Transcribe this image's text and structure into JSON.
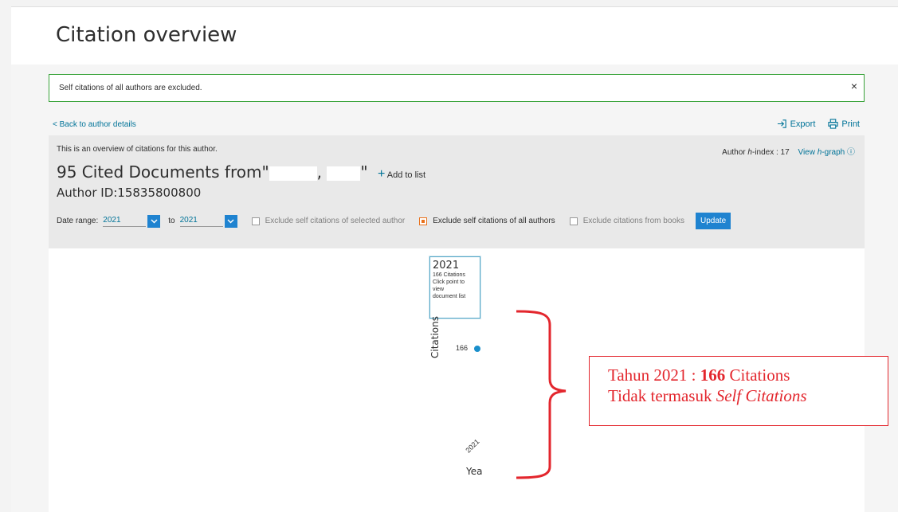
{
  "page": {
    "title": "Citation overview"
  },
  "notice": {
    "text": "Self citations of all authors are excluded.",
    "close": "×"
  },
  "nav": {
    "back": "< Back to author details",
    "export": "Export",
    "print": "Print"
  },
  "overview": {
    "intro": "This is an overview of citations for this author.",
    "hindex_prefix": "Author ",
    "hindex_h": "h",
    "hindex_suffix": "-index : 17",
    "view_prefix": "View ",
    "view_h": "h",
    "view_suffix": "-graph",
    "docs_prefix": "95 Cited Documents from\"",
    "docs_comma": ",",
    "docs_quote": "\"",
    "add_to_list": "Add to list",
    "author_id": "Author ID:15835800800"
  },
  "filters": {
    "date_range_label": "Date range:",
    "from_value": "2021",
    "to_label": "to",
    "to_value": "2021",
    "exclude_selected": "Exclude self citations of selected author",
    "exclude_all": "Exclude self citations of all authors",
    "exclude_books": "Exclude citations from books",
    "update": "Update"
  },
  "chart_data": {
    "type": "scatter",
    "x": [
      "2021"
    ],
    "values": [
      166
    ],
    "ylabel": "Citations",
    "xlabel": "Yea",
    "tooltip": {
      "year": "2021",
      "lines": [
        "166 Citations",
        "Click point to",
        "view",
        "document list"
      ]
    },
    "point_color": "#1a8fcb"
  },
  "annotation": {
    "line1_prefix": "Tahun 2021 : ",
    "line1_bold": "166",
    "line1_suffix": " Citations",
    "line2_prefix": "Tidak termasuk ",
    "line2_italic": "Self Citations",
    "color": "#e3262d"
  }
}
